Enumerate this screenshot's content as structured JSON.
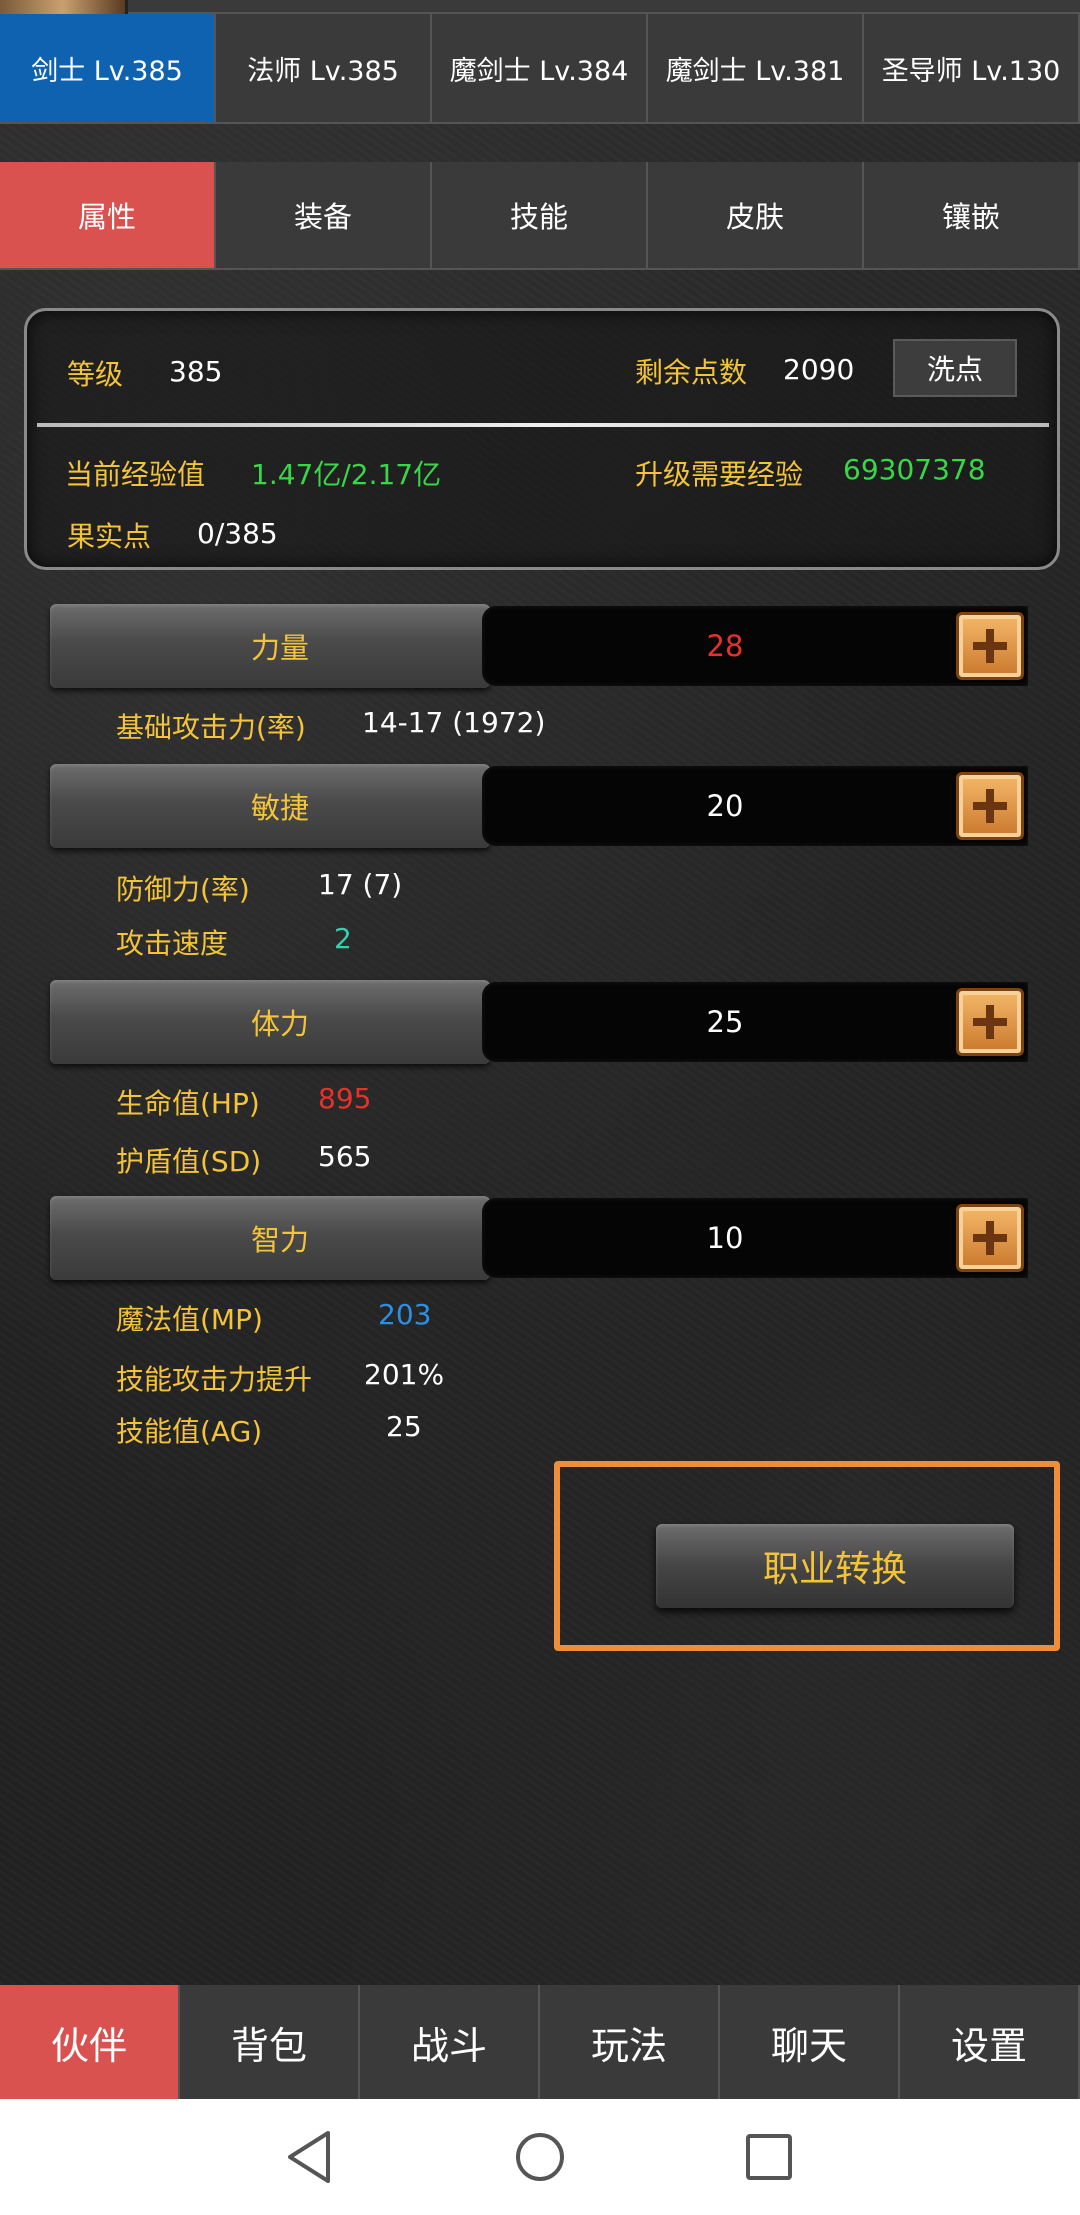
{
  "class_tabs": [
    {
      "label": "剑士 Lv.385",
      "active": true
    },
    {
      "label": "法师 Lv.385",
      "active": false
    },
    {
      "label": "魔剑士 Lv.384",
      "active": false
    },
    {
      "label": "魔剑士 Lv.381",
      "active": false
    },
    {
      "label": "圣导师 Lv.130",
      "active": false
    }
  ],
  "sub_tabs": [
    {
      "label": "属性",
      "active": true
    },
    {
      "label": "装备",
      "active": false
    },
    {
      "label": "技能",
      "active": false
    },
    {
      "label": "皮肤",
      "active": false
    },
    {
      "label": "镶嵌",
      "active": false
    }
  ],
  "info": {
    "level_label": "等级",
    "level_value": "385",
    "points_label": "剩余点数",
    "points_value": "2090",
    "reset_button": "洗点",
    "exp_label": "当前经验值",
    "exp_value": "1.47亿/2.17亿",
    "next_exp_label": "升级需要经验",
    "next_exp_value": "69307378",
    "fruit_label": "果实点",
    "fruit_value": "0/385"
  },
  "stats": [
    {
      "name": "力量",
      "value": "28",
      "value_color": "#e8312a",
      "details": [
        {
          "label": "基础攻击力(率)",
          "value": "14-17 (1972)"
        }
      ]
    },
    {
      "name": "敏捷",
      "value": "20",
      "value_color": "#ffffff",
      "details": [
        {
          "label": "防御力(率)",
          "value": "17 (7)"
        },
        {
          "label": "攻击速度",
          "value": "2",
          "color": "#2fd3b0"
        }
      ]
    },
    {
      "name": "体力",
      "value": "25",
      "value_color": "#ffffff",
      "details": [
        {
          "label": "生命值(HP)",
          "value": "895",
          "color": "#e8312a"
        },
        {
          "label": "护盾值(SD)",
          "value": "565"
        }
      ]
    },
    {
      "name": "智力",
      "value": "10",
      "value_color": "#ffffff",
      "details": [
        {
          "label": "魔法值(MP)",
          "value": "203",
          "color": "#2b8fe6"
        },
        {
          "label": "技能攻击力提升",
          "value": "201%"
        },
        {
          "label": "技能值(AG)",
          "value": "25"
        }
      ]
    }
  ],
  "class_change_button": "职业转换",
  "bottom_nav": [
    {
      "label": "伙伴",
      "active": true
    },
    {
      "label": "背包",
      "active": false
    },
    {
      "label": "战斗",
      "active": false
    },
    {
      "label": "玩法",
      "active": false
    },
    {
      "label": "聊天",
      "active": false
    },
    {
      "label": "设置",
      "active": false
    }
  ],
  "system_nav": [
    "back-icon",
    "home-icon",
    "recents-icon"
  ],
  "colors": {
    "active_tab_blue": "#0f62b0",
    "active_tab_red": "#d9524f",
    "gold_text": "#f3c33a",
    "exp_green": "#3ad64a",
    "highlight_orange": "#ef8e3a"
  }
}
